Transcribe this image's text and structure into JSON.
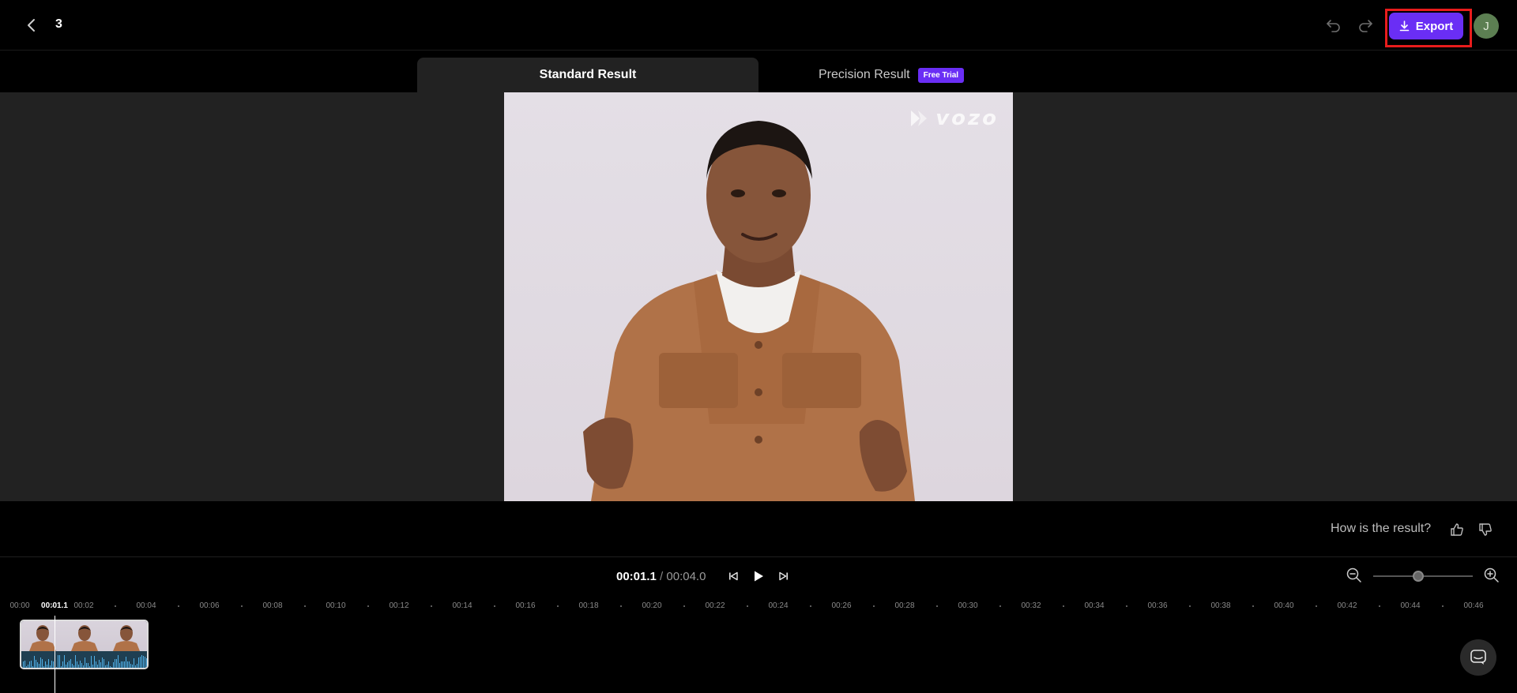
{
  "header": {
    "project_title": "3",
    "export_label": "Export",
    "avatar_initial": "J",
    "accent_color": "#6a2ef5",
    "highlight_color": "#e81c1c"
  },
  "tabs": {
    "standard_label": "Standard Result",
    "precision_label": "Precision Result",
    "trial_badge": "Free Trial",
    "active": "Standard Result"
  },
  "video": {
    "watermark": "vozo"
  },
  "feedback": {
    "question": "How is the result?"
  },
  "player": {
    "current_time": "00:01.1",
    "separator": " / ",
    "total_time": "00:04.0",
    "zoom_level_fraction": 0.45
  },
  "timeline": {
    "current_label": "00:01.1",
    "tick_labels": [
      "00:00",
      "00:02",
      "00:04",
      "00:06",
      "00:08",
      "00:10",
      "00:12",
      "00:14",
      "00:16",
      "00:18",
      "00:20",
      "00:22",
      "00:24",
      "00:26",
      "00:28",
      "00:30",
      "00:32",
      "00:34",
      "00:36",
      "00:38",
      "00:40",
      "00:42",
      "00:44",
      "00:46"
    ]
  },
  "icons": {
    "back": "chevron-left-icon",
    "undo": "undo-icon",
    "redo": "redo-icon",
    "export": "download-icon",
    "thumb_up": "thumb-up-icon",
    "thumb_down": "thumb-down-icon",
    "prev": "skip-previous-icon",
    "play": "play-icon",
    "next": "skip-next-icon",
    "zoom_out": "zoom-out-icon",
    "zoom_in": "zoom-in-icon",
    "chat": "chat-icon"
  }
}
